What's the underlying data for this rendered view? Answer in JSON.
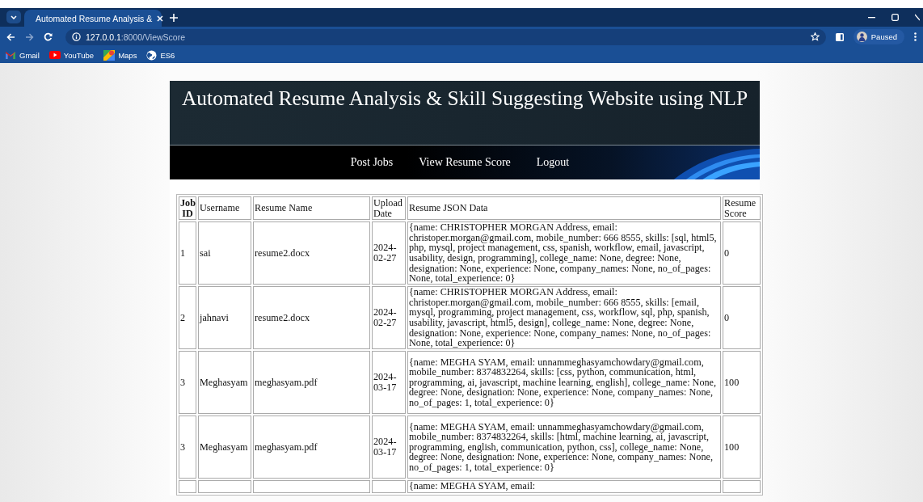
{
  "browser": {
    "tabs": [
      {
        "title": "Automated Resume Analysis &",
        "selected": true
      }
    ],
    "address": {
      "host": "127.0.0.1",
      "path": ":8000/ViewScore"
    },
    "bookmarks": [
      {
        "label": "Gmail",
        "kind": "mail"
      },
      {
        "label": "YouTube",
        "kind": "video"
      },
      {
        "label": "Maps",
        "kind": "map"
      },
      {
        "label": "ES6",
        "kind": "globe"
      }
    ],
    "profile": {
      "label": "Paused"
    }
  },
  "site": {
    "title": "Automated Resume Analysis & Skill Suggesting Website using NLP",
    "nav": [
      {
        "label": "Post Jobs"
      },
      {
        "label": "View Resume Score"
      },
      {
        "label": "Logout"
      }
    ]
  },
  "table": {
    "columns": [
      "Job ID",
      "Username",
      "Resume Name",
      "Upload Date",
      "Resume JSON Data",
      "Resume Score"
    ],
    "rows": [
      [
        "1",
        "sai",
        "resume2.docx",
        "2024-02-27",
        "{name: CHRISTOPHER MORGAN Address, email: christoper.morgan@gmail.com, mobile_number: 666 8555, skills: [sql, html5, php, mysql, project management, css, spanish, workflow, email, javascript, usability, design, programming], college_name: None, degree: None, designation: None, experience: None, company_names: None, no_of_pages: None, total_experience: 0}",
        "0"
      ],
      [
        "2",
        "jahnavi",
        "resume2.docx",
        "2024-02-27",
        "{name: CHRISTOPHER MORGAN Address, email: christoper.morgan@gmail.com, mobile_number: 666 8555, skills: [email, mysql, programming, project management, css, workflow, sql, php, spanish, usability, javascript, html5, design], college_name: None, degree: None, designation: None, experience: None, company_names: None, no_of_pages: None, total_experience: 0}",
        "0"
      ],
      [
        "3",
        "Meghasyam",
        "meghasyam.pdf",
        "2024-03-17",
        "{name: MEGHA SYAM, email: unnammeghasyamchowdary@gmail.com, mobile_number: 8374832264, skills: [css, python, communication, html, programming, ai, javascript, machine learning, english], college_name: None, degree: None, designation: None, experience: None, company_names: None, no_of_pages: 1, total_experience: 0}",
        "100"
      ],
      [
        "3",
        "Meghasyam",
        "meghasyam.pdf",
        "2024-03-17",
        "{name: MEGHA SYAM, email: unnammeghasyamchowdary@gmail.com, mobile_number: 8374832264, skills: [html, machine learning, ai, javascript, programming, english, communication, python, css], college_name: None, degree: None, designation: None, experience: None, company_names: None, no_of_pages: 1, total_experience: 0}",
        "100"
      ],
      [
        "",
        "",
        "",
        "",
        "{name: MEGHA SYAM, email:",
        ""
      ]
    ]
  }
}
